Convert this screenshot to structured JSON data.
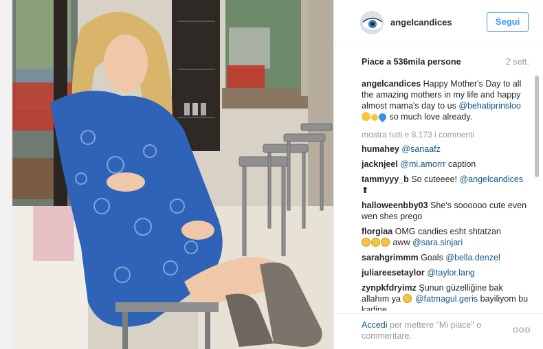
{
  "post": {
    "username": "angelcandices",
    "follow_label": "Segui",
    "likes": "Piace a 536mila persone",
    "date": "2 sett.",
    "caption": {
      "user": "angelcandices",
      "text_before": "Happy Mother's Day to all the amazing mothers in my life and happy almost mama's day to us",
      "mention": "@behatiprinsloo",
      "text_after": "so much love already."
    },
    "show_all": "mostra tutti e 8.173 i commenti",
    "comments": [
      {
        "user": "humahey",
        "pre": "",
        "mention": "@sanaafz",
        "post": ""
      },
      {
        "user": "jacknjeel",
        "pre": "",
        "mention": "@mi.amorrr",
        "post": "caption"
      },
      {
        "user": "tammyyy_b",
        "pre": "So cuteeee!",
        "mention": "@angelcandices",
        "post": "⬆"
      },
      {
        "user": "halloweenbby03",
        "pre": "She's soooooo cute even wen shes prego",
        "mention": "",
        "post": ""
      },
      {
        "user": "florgiaa",
        "pre": "OMG candies esht shtatzan",
        "mention": "@sara.sinjari",
        "post": ""
      },
      {
        "user": "sarahgrimmm",
        "pre": "Goals",
        "mention": "@bella.denzel",
        "post": ""
      },
      {
        "user": "juliareesetaylor",
        "pre": "",
        "mention": "@taylor.lang",
        "post": ""
      },
      {
        "user": "zynpkfdryimz",
        "pre": "Şunun güzelliğine bak allahım ya",
        "mention": "@fatmagul.geris",
        "post": "bayiliyom bu kadine"
      }
    ],
    "florgiaa_aww": "aww",
    "footer": {
      "login_link": "Accedi",
      "login_rest": "per mettere \"Mi piace\" o commentare."
    },
    "more_glyph": "ooo"
  },
  "colors": {
    "link": "#125688",
    "follow": "#3897f0",
    "muted": "#999999"
  },
  "icons": {
    "avatar": "avatar-eye-icon",
    "more": "more-options-icon"
  }
}
